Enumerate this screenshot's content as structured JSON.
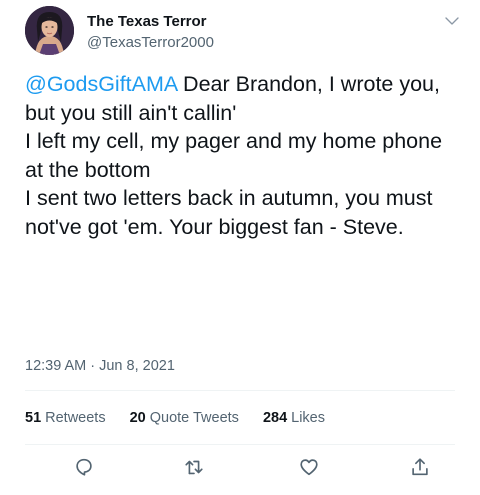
{
  "author": {
    "display_name": "The Texas Terror",
    "handle": "@TexasTerror2000"
  },
  "tweet": {
    "mention": "@GodsGiftAMA",
    "text": " Dear Brandon, I wrote you, but you still ain't callin'\nI left my cell, my pager and my home phone at the bottom\nI sent two letters back in autumn, you must not've got 'em. Your biggest fan - Steve."
  },
  "meta": {
    "time": "12:39 AM",
    "separator": "·",
    "date": "Jun 8, 2021"
  },
  "stats": {
    "retweets_count": "51",
    "retweets_label": "Retweets",
    "quotes_count": "20",
    "quotes_label": "Quote Tweets",
    "likes_count": "284",
    "likes_label": "Likes"
  },
  "icons": {
    "more": "chevron-down-icon",
    "reply": "reply-icon",
    "retweet": "retweet-icon",
    "like": "heart-icon",
    "share": "share-icon"
  },
  "colors": {
    "accent": "#1d9bf0",
    "text": "#0f1419",
    "secondary": "#536471",
    "divider": "#eff3f4"
  }
}
